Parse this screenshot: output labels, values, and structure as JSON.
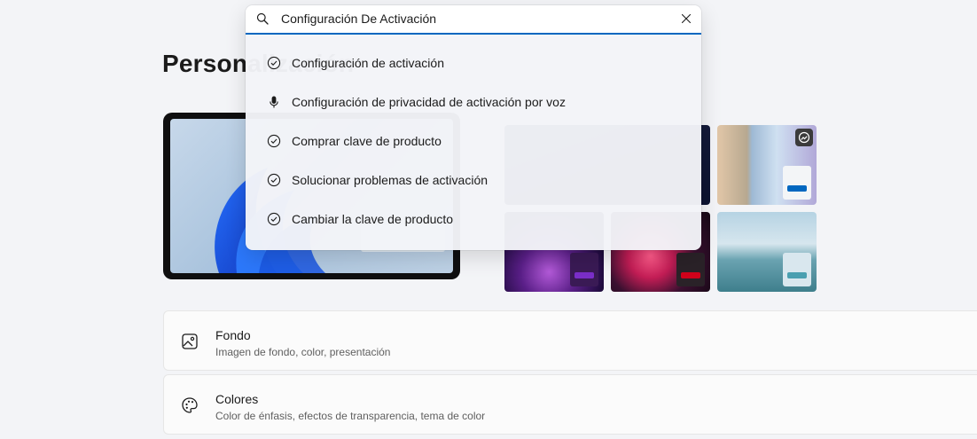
{
  "page": {
    "title": "Personalización"
  },
  "search": {
    "value": "Configuración De Activación",
    "results": [
      {
        "label": "Configuración de activación",
        "icon": "check-circle-icon"
      },
      {
        "label": "Configuración de privacidad de activación por voz",
        "icon": "microphone-icon"
      },
      {
        "label": "Comprar clave de producto",
        "icon": "check-circle-icon"
      },
      {
        "label": "Solucionar problemas de activación",
        "icon": "check-circle-icon"
      },
      {
        "label": "Cambiar la clave de producto",
        "icon": "check-circle-icon"
      }
    ]
  },
  "themes": {
    "swatch_colors": [
      "#0067c0",
      "#7a2ec8",
      "#d0021b",
      "#4a9fb0"
    ]
  },
  "cards": [
    {
      "title": "Fondo",
      "subtitle": "Imagen de fondo, color, presentación",
      "icon": "image-icon"
    },
    {
      "title": "Colores",
      "subtitle": "Color de énfasis, efectos de transparencia, tema de color",
      "icon": "palette-icon"
    }
  ]
}
